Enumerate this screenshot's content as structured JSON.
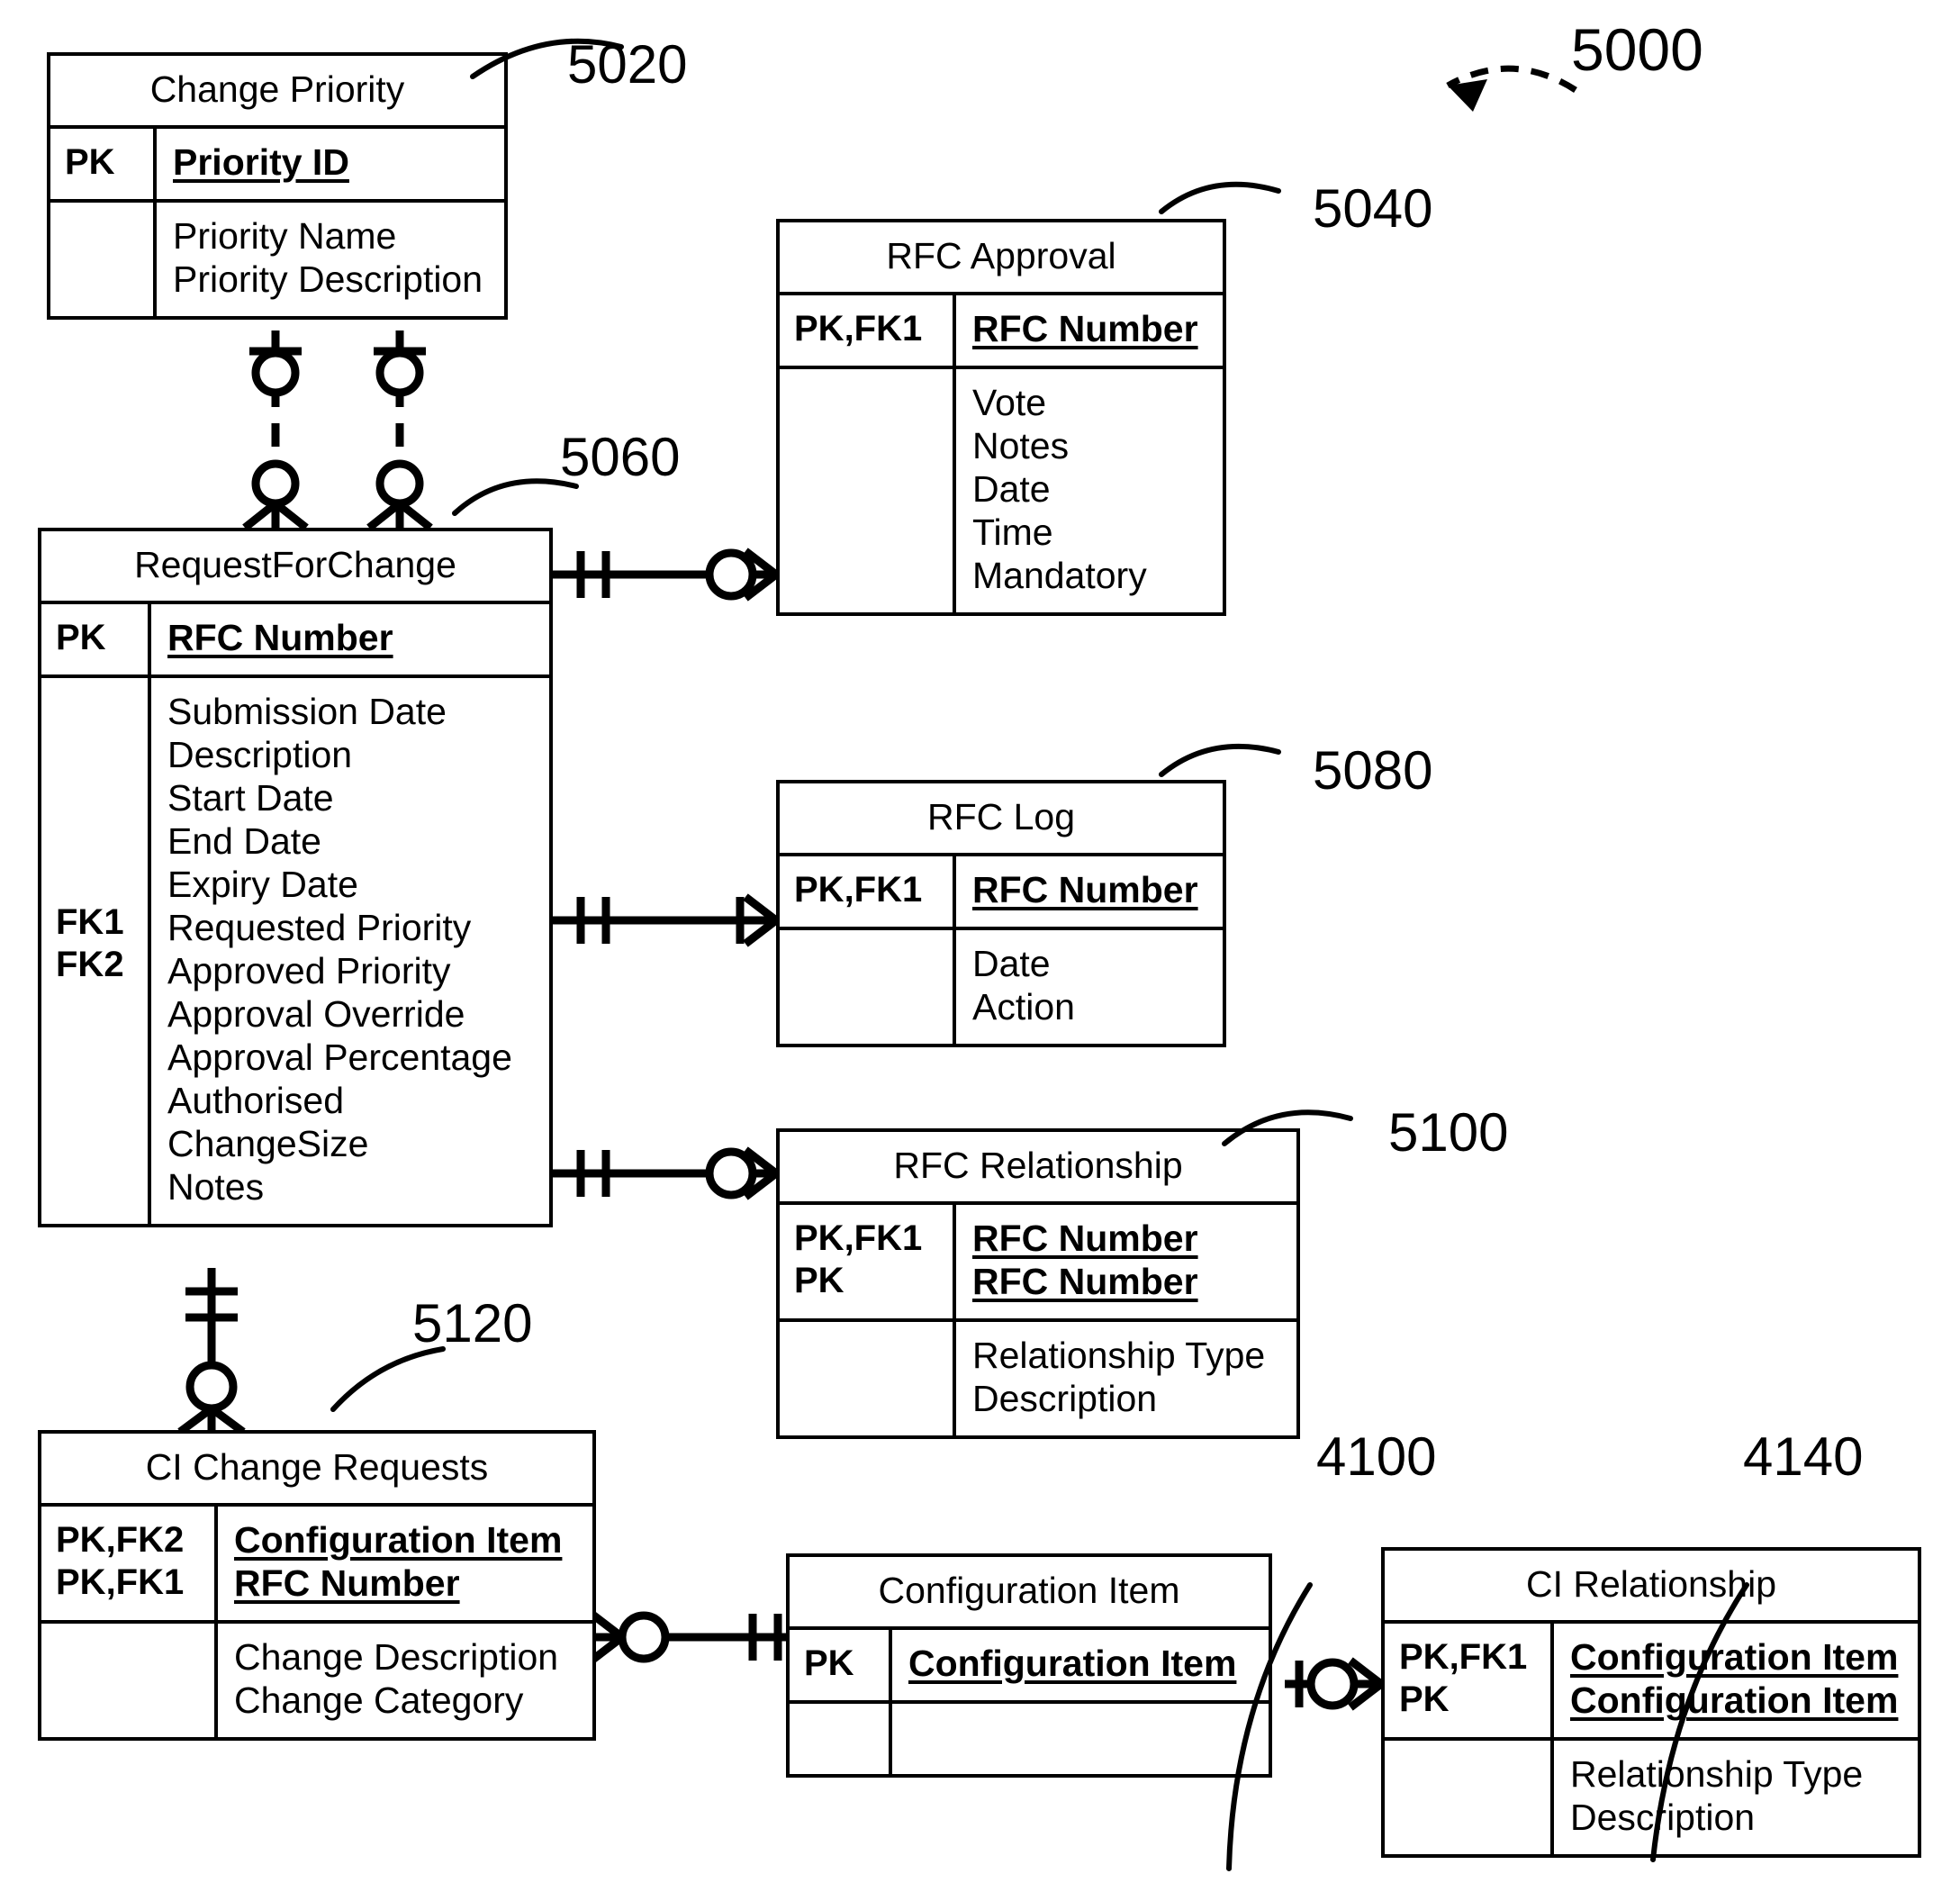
{
  "diagram": {
    "figure_label": "5000",
    "style": "crows-foot ER diagram (IDEF1X / information engineering notation)",
    "background": "#ffffff",
    "line_color": "#000000"
  },
  "reference_numbers": {
    "figure": "5000",
    "change_priority": "5020",
    "rfc_approval": "5040",
    "request_for_change": "5060",
    "rfc_log": "5080",
    "rfc_relationship": "5100",
    "ci_change_requests": "5120",
    "configuration_item": "4100",
    "ci_relationship": "4140"
  },
  "entities": {
    "change_priority": {
      "title": "Change Priority",
      "key_section": {
        "keys": [
          "PK"
        ],
        "attributes": [
          "Priority ID"
        ],
        "pk": true
      },
      "attr_section": {
        "keys": [],
        "attributes": [
          "Priority Name",
          "Priority Description"
        ]
      }
    },
    "rfc_approval": {
      "title": "RFC Approval",
      "key_section": {
        "keys": [
          "PK,FK1"
        ],
        "attributes": [
          "RFC Number"
        ],
        "pk": true
      },
      "attr_section": {
        "keys": [],
        "attributes": [
          "Vote",
          "Notes",
          "Date",
          "Time",
          "Mandatory"
        ]
      }
    },
    "request_for_change": {
      "title": "RequestForChange",
      "key_section": {
        "keys": [
          "PK"
        ],
        "attributes": [
          "RFC Number"
        ],
        "pk": true
      },
      "attr_section": {
        "keys": [
          "",
          "",
          "",
          "",
          "",
          "FK1",
          "FK2",
          "",
          "",
          "",
          "",
          ""
        ],
        "attributes": [
          "Submission Date",
          "Description",
          "Start Date",
          "End Date",
          "Expiry Date",
          "Requested Priority",
          "Approved Priority",
          "Approval Override",
          "Approval Percentage",
          "Authorised",
          "ChangeSize",
          "Notes"
        ]
      }
    },
    "rfc_log": {
      "title": "RFC Log",
      "key_section": {
        "keys": [
          "PK,FK1"
        ],
        "attributes": [
          "RFC Number"
        ],
        "pk": true
      },
      "attr_section": {
        "keys": [],
        "attributes": [
          "Date",
          "Action"
        ]
      }
    },
    "rfc_relationship": {
      "title": "RFC Relationship",
      "key_section": {
        "keys": [
          "PK,FK1",
          "PK"
        ],
        "attributes": [
          "RFC Number",
          "RFC Number"
        ],
        "pk": true
      },
      "attr_section": {
        "keys": [],
        "attributes": [
          "Relationship Type",
          "Description"
        ]
      }
    },
    "ci_change_requests": {
      "title": "CI Change Requests",
      "key_section": {
        "keys": [
          "PK,FK2",
          "PK,FK1"
        ],
        "attributes": [
          "Configuration Item",
          "RFC Number"
        ],
        "pk": true
      },
      "attr_section": {
        "keys": [],
        "attributes": [
          "Change Description",
          "Change Category"
        ]
      }
    },
    "configuration_item": {
      "title": "Configuration Item",
      "key_section": {
        "keys": [
          "PK"
        ],
        "attributes": [
          "Configuration Item"
        ],
        "pk": true
      },
      "attr_section": {
        "keys": [],
        "attributes": []
      }
    },
    "ci_relationship": {
      "title": "CI Relationship",
      "key_section": {
        "keys": [
          "PK,FK1",
          "PK"
        ],
        "attributes": [
          "Configuration Item",
          "Configuration Item"
        ],
        "pk": true
      },
      "attr_section": {
        "keys": [],
        "attributes": [
          "Relationship Type",
          "Description"
        ]
      }
    }
  },
  "relationships": [
    {
      "name": "change-priority-to-rfc-requested",
      "from": "Change Priority",
      "to": "RequestForChange",
      "line_style": "dashed",
      "from_cardinality": "one-optional",
      "to_cardinality": "zero-or-many"
    },
    {
      "name": "change-priority-to-rfc-approved",
      "from": "Change Priority",
      "to": "RequestForChange",
      "line_style": "dashed",
      "from_cardinality": "one-optional",
      "to_cardinality": "zero-or-many"
    },
    {
      "name": "rfc-to-rfc-approval",
      "from": "RequestForChange",
      "to": "RFC Approval",
      "line_style": "solid",
      "from_cardinality": "one-and-only-one",
      "to_cardinality": "zero-or-many"
    },
    {
      "name": "rfc-to-rfc-log",
      "from": "RequestForChange",
      "to": "RFC Log",
      "line_style": "solid",
      "from_cardinality": "one-and-only-one",
      "to_cardinality": "one-or-many"
    },
    {
      "name": "rfc-to-rfc-relationship",
      "from": "RequestForChange",
      "to": "RFC Relationship",
      "line_style": "solid",
      "from_cardinality": "one-and-only-one",
      "to_cardinality": "zero-or-many"
    },
    {
      "name": "rfc-to-ci-change-requests",
      "from": "RequestForChange",
      "to": "CI Change Requests",
      "line_style": "solid",
      "from_cardinality": "one-and-only-one",
      "to_cardinality": "zero-or-many"
    },
    {
      "name": "ci-change-requests-to-configuration-item",
      "from": "CI Change Requests",
      "to": "Configuration Item",
      "line_style": "solid",
      "from_cardinality": "zero-or-many",
      "to_cardinality": "one-and-only-one"
    },
    {
      "name": "configuration-item-to-ci-relationship",
      "from": "Configuration Item",
      "to": "CI Relationship",
      "line_style": "solid",
      "from_cardinality": "one",
      "to_cardinality": "zero-or-many"
    }
  ]
}
